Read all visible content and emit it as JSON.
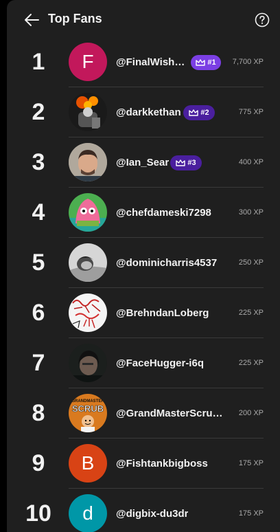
{
  "header": {
    "title": "Top Fans"
  },
  "fans": [
    {
      "rank": "1",
      "handle": "@FinalWish4…",
      "xp": "7,700 XP",
      "badge": "#1",
      "avatar_letter": "F",
      "avatar_color": "#c2185b"
    },
    {
      "rank": "2",
      "handle": "@darkkethan",
      "xp": "775 XP",
      "badge": "#2"
    },
    {
      "rank": "3",
      "handle": "@Ian_Sear",
      "xp": "400 XP",
      "badge": "#3"
    },
    {
      "rank": "4",
      "handle": "@chefdameski7298",
      "xp": "300 XP"
    },
    {
      "rank": "5",
      "handle": "@dominicharris4537",
      "xp": "250 XP"
    },
    {
      "rank": "6",
      "handle": "@BrehndanLoberg",
      "xp": "225 XP"
    },
    {
      "rank": "7",
      "handle": "@FaceHugger-i6q",
      "xp": "225 XP"
    },
    {
      "rank": "8",
      "handle": "@GrandMasterScrub…",
      "xp": "200 XP",
      "avatar_text": "SCRUB",
      "avatar_text_top": "GRANDMASTER"
    },
    {
      "rank": "9",
      "handle": "@Fishtankbigboss",
      "xp": "175 XP",
      "avatar_letter": "B",
      "avatar_color": "#d84315"
    },
    {
      "rank": "10",
      "handle": "@digbix-du3dr",
      "xp": "175 XP",
      "avatar_letter": "d",
      "avatar_color": "#0097a7"
    }
  ],
  "colors": {
    "badge_1": "#7b3fe4",
    "badge_2": "#4a1f9e",
    "badge_3": "#4a1f9e"
  }
}
